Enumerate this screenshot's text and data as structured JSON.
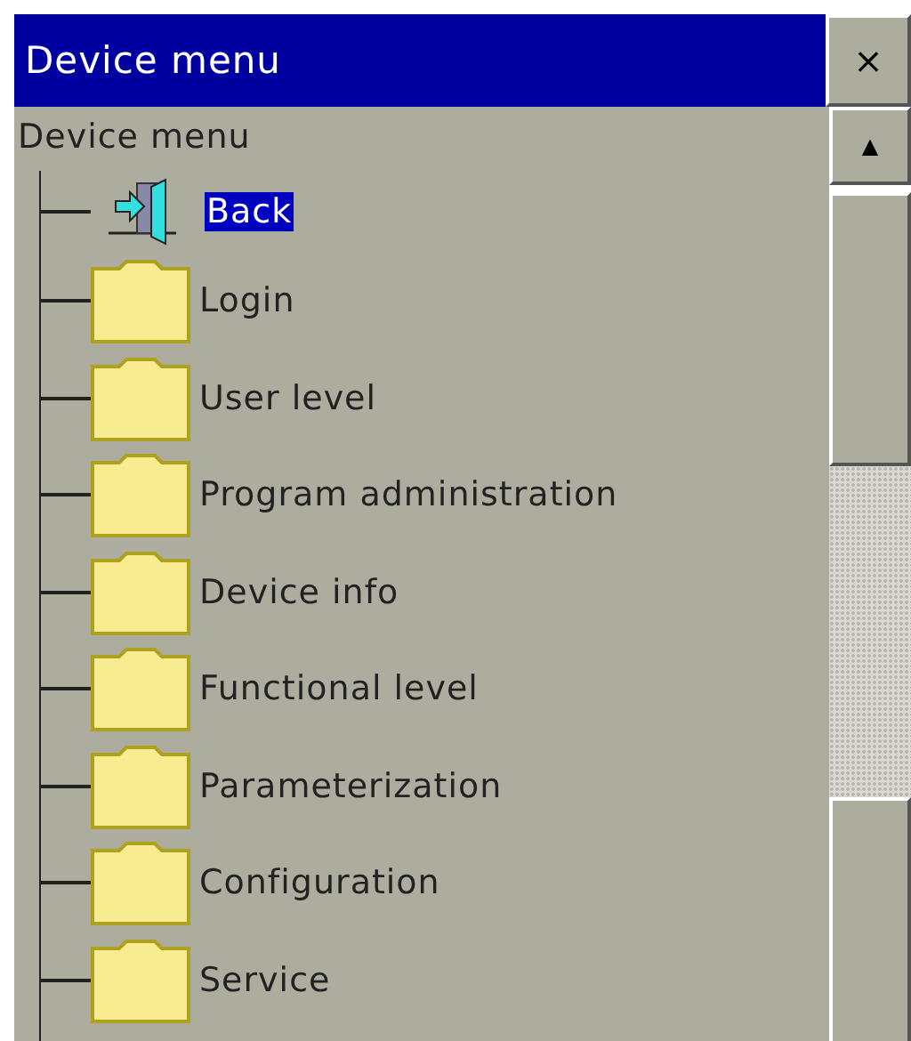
{
  "window": {
    "title": "Device menu",
    "close": "×"
  },
  "scrollbar": {
    "up": "▲"
  },
  "tree": {
    "root": "Device menu",
    "items": [
      {
        "kind": "back",
        "label": "Back",
        "selected": true
      },
      {
        "kind": "folder",
        "label": "Login",
        "selected": false
      },
      {
        "kind": "folder",
        "label": "User level",
        "selected": false
      },
      {
        "kind": "folder",
        "label": "Program administration",
        "selected": false
      },
      {
        "kind": "folder",
        "label": "Device info",
        "selected": false
      },
      {
        "kind": "folder",
        "label": "Functional level",
        "selected": false
      },
      {
        "kind": "folder",
        "label": "Parameterization",
        "selected": false
      },
      {
        "kind": "folder",
        "label": "Configuration",
        "selected": false
      },
      {
        "kind": "folder",
        "label": "Service",
        "selected": false
      }
    ]
  }
}
